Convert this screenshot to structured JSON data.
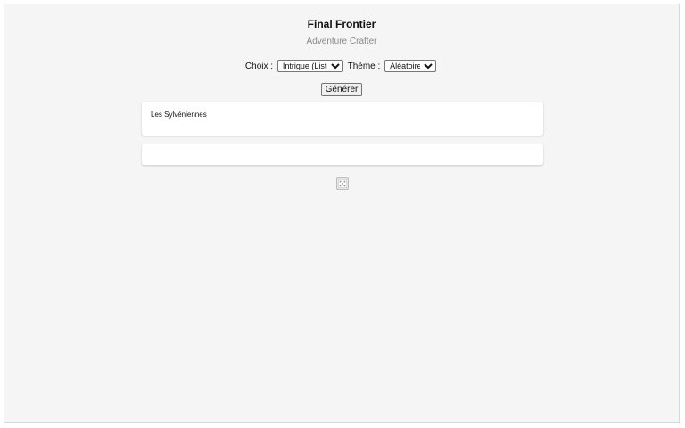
{
  "header": {
    "title": "Final Frontier",
    "subtitle": "Adventure Crafter"
  },
  "controls": {
    "choix_label": "Choix :",
    "choix_value": "Intrigue (Liste)",
    "theme_label": "Thème :",
    "theme_value": "Aléatoire"
  },
  "generate_button": "Générer",
  "result": {
    "text": "Les Sylvéniennes",
    "secondary_text": ""
  },
  "icons": {
    "roll": "dice-icon"
  },
  "colors": {
    "background": "#f5f5f5",
    "card": "#ffffff",
    "subtitle": "#888888"
  }
}
